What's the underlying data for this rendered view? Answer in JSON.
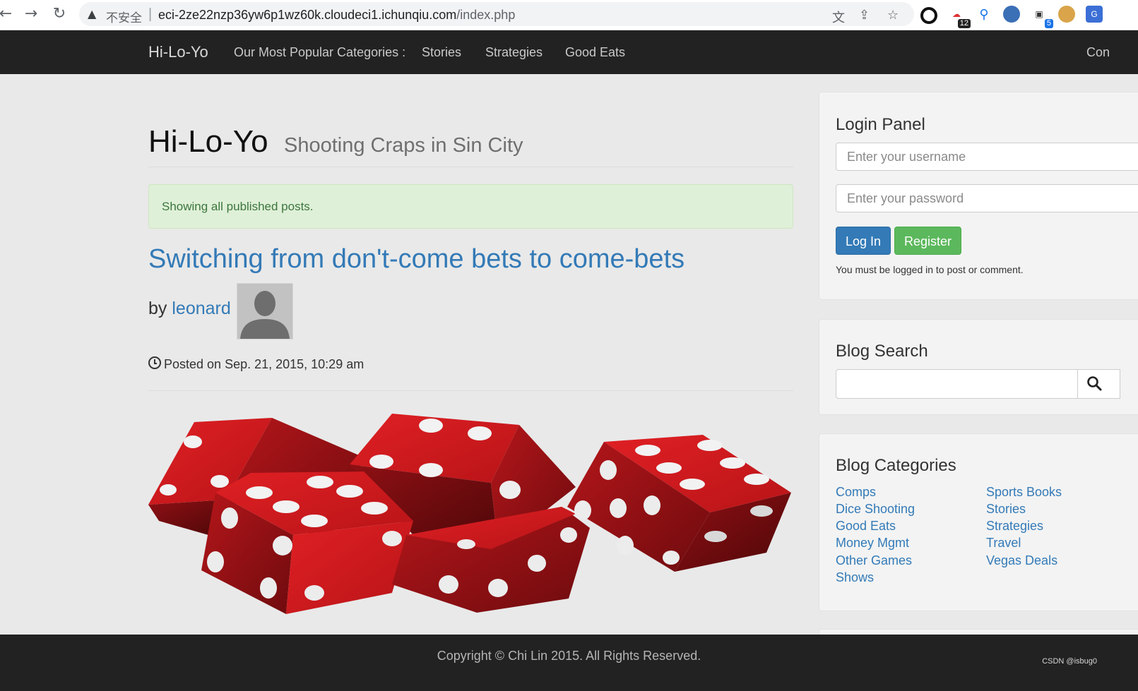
{
  "browser": {
    "back_icon": "back-arrow-icon",
    "forward_icon": "forward-arrow-icon",
    "reload_icon": "reload-icon",
    "security_label": "不安全",
    "url_host": "eci-2ze22nzp36yw6p1wz60k.cloudeci1.ichunqiu.com",
    "url_path": "/index.php",
    "extension_badge_a": "12",
    "extension_badge_b": "5"
  },
  "navbar": {
    "brand": "Hi-Lo-Yo",
    "popular_label": "Our Most Popular Categories :",
    "links": [
      "Stories",
      "Strategies",
      "Good Eats"
    ],
    "right_link": "Con"
  },
  "header": {
    "title": "Hi-Lo-Yo",
    "subtitle": "Shooting Craps in Sin City"
  },
  "alert": {
    "text": "Showing all published posts."
  },
  "post": {
    "title": "Switching from don't-come bets to come-bets",
    "by_label": "by",
    "author": "leonard",
    "posted": "Posted on Sep. 21, 2015, 10:29 am"
  },
  "login": {
    "title": "Login Panel",
    "username_placeholder": "Enter your username",
    "password_placeholder": "Enter your password",
    "login_button": "Log In",
    "register_button": "Register",
    "note": "You must be logged in to post or comment."
  },
  "search": {
    "title": "Blog Search"
  },
  "categories": {
    "title": "Blog Categories",
    "left": [
      "Comps",
      "Dice Shooting",
      "Good Eats",
      "Money Mgmt",
      "Other Games",
      "Shows"
    ],
    "right": [
      "Sports Books",
      "Stories",
      "Strategies",
      "Travel",
      "Vegas Deals"
    ]
  },
  "footer": {
    "copyright": "Copyright © Chi Lin 2015. All Rights Reserved.",
    "watermark": "CSDN @isbug0"
  },
  "colors": {
    "link": "#337ab7",
    "navbar": "#222222",
    "alert_bg": "#dff0d8",
    "alert_text": "#3c763d",
    "primary_btn": "#337ab7",
    "success_btn": "#5cb85c",
    "dice_red": "#c8171b"
  }
}
